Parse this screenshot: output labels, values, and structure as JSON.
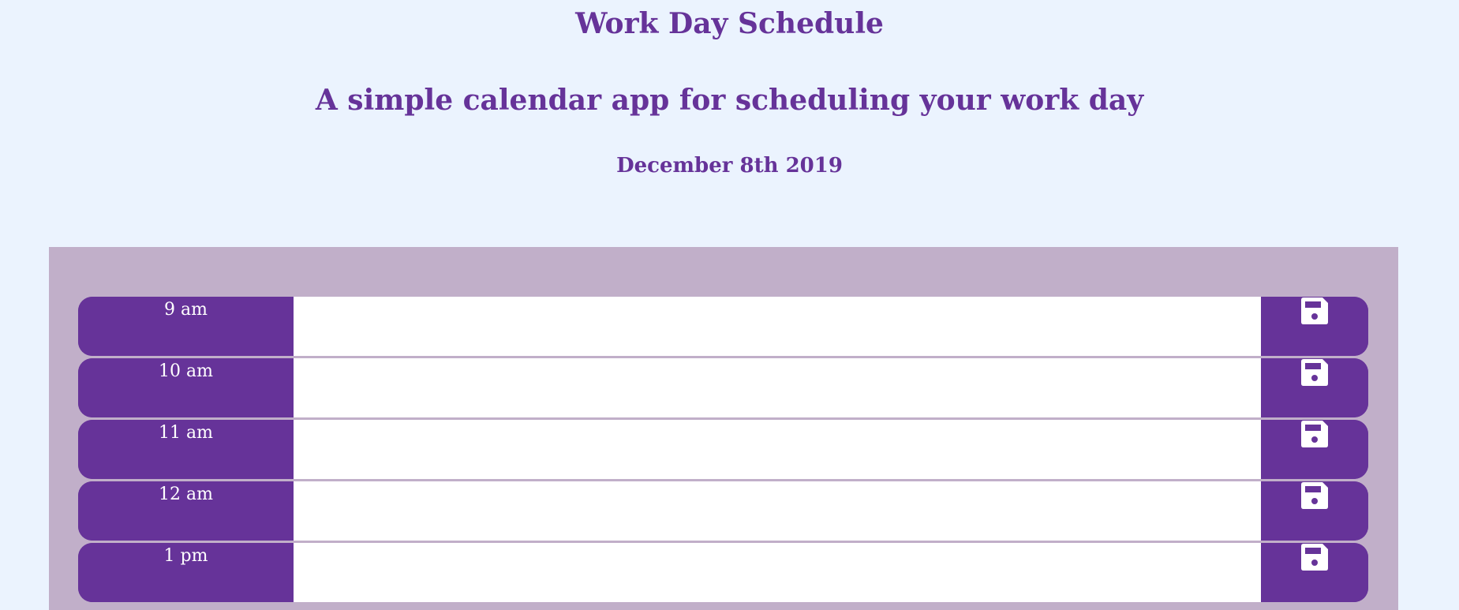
{
  "header": {
    "title": "Work Day Schedule",
    "subtitle": "A simple calendar app for scheduling your work day",
    "date": "December 8th 2019"
  },
  "rows": [
    {
      "hour": "9 am",
      "task": "",
      "save_icon": "floppy-disk-icon"
    },
    {
      "hour": "10 am",
      "task": "",
      "save_icon": "floppy-disk-icon"
    },
    {
      "hour": "11 am",
      "task": "",
      "save_icon": "floppy-disk-icon"
    },
    {
      "hour": "12 am",
      "task": "",
      "save_icon": "floppy-disk-icon"
    },
    {
      "hour": "1 pm",
      "task": "",
      "save_icon": "floppy-disk-icon"
    }
  ],
  "colors": {
    "background": "#ebf3fe",
    "accent": "#663399",
    "container": "#c1afc9",
    "input": "#ffffff"
  }
}
